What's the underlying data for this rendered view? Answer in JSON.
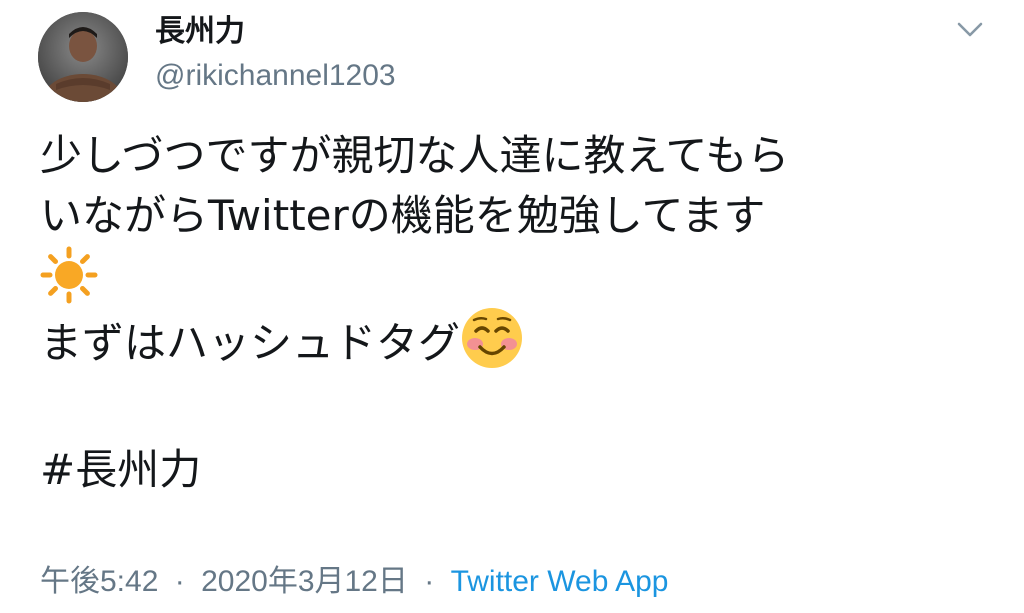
{
  "tweet": {
    "author": {
      "display_name": "長州力",
      "handle": "@rikichannel1203"
    },
    "body": {
      "line1": "少しづつですが親切な人達に教えてもら",
      "line2": "いながらTwitterの機能を勉強してます",
      "line3_emoji": "sun-emoji",
      "line4": "まずはハッシュドタグ",
      "line4_emoji": "smiling-face-emoji",
      "line5": "#長州力"
    },
    "meta": {
      "time": "午後5:42",
      "separator": "·",
      "date": "2020年3月12日",
      "source": "Twitter Web App"
    }
  },
  "icons": {
    "menu": "chevron-down-icon"
  },
  "colors": {
    "text": "#14171a",
    "secondary": "#657786",
    "link": "#1b95e0",
    "background": "#ffffff"
  }
}
